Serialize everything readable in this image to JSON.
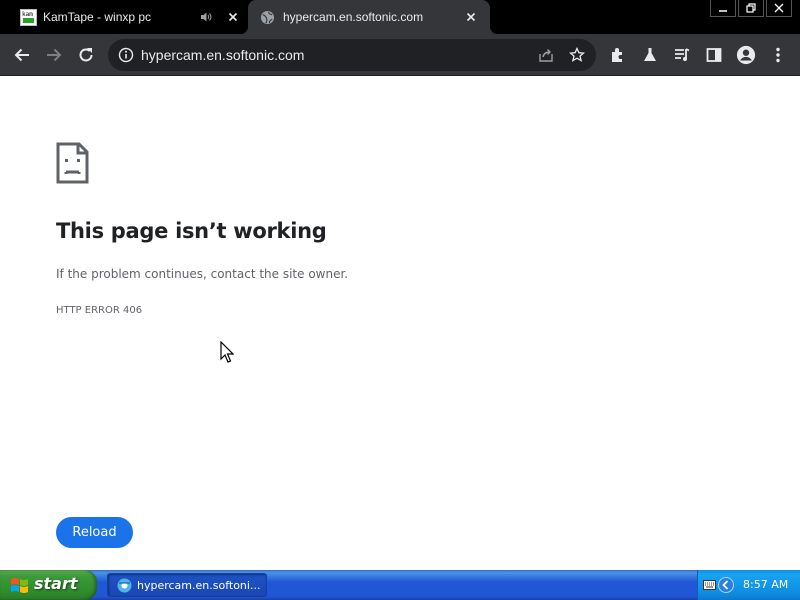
{
  "browser": {
    "tabs": [
      {
        "title": "KamTape - winxp pc",
        "favicon_text": "kam",
        "audio": true,
        "active": false
      },
      {
        "title": "hypercam.en.softonic.com",
        "active": true
      }
    ],
    "address": "hypercam.en.softonic.com",
    "toolbar_icons": [
      "back-icon",
      "forward-icon",
      "reload-icon",
      "info-icon",
      "share-icon",
      "star-icon",
      "extensions-icon",
      "labs-icon",
      "media-icon",
      "sidepanel-icon",
      "profile-icon",
      "menu-icon"
    ]
  },
  "page": {
    "error_title": "This page isn’t working",
    "error_desc": "If the problem continues, contact the site owner.",
    "error_code": "HTTP ERROR 406",
    "reload_label": "Reload"
  },
  "taskbar": {
    "start_label": "start",
    "task_label": "hypercam.en.softoni...",
    "clock": "8:57 AM"
  },
  "colors": {
    "accent": "#1a73e8",
    "tab_bg": "#35363a",
    "taskbar_blue": "#2157d7",
    "start_green": "#3c9b3a"
  }
}
